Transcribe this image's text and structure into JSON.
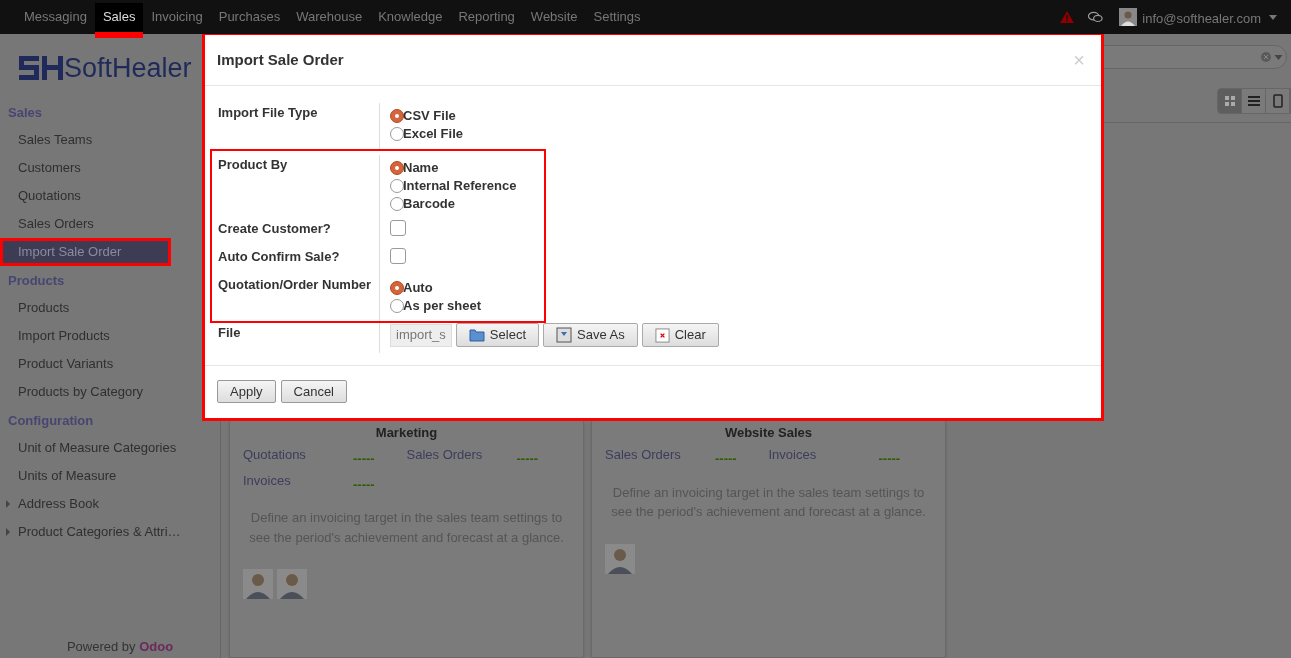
{
  "navbar": {
    "menu": [
      {
        "label": "Messaging",
        "selected": false,
        "highlighted": false
      },
      {
        "label": "Sales",
        "selected": true,
        "highlighted": true
      },
      {
        "label": "Invoicing",
        "selected": false,
        "highlighted": false
      },
      {
        "label": "Purchases",
        "selected": false,
        "highlighted": false
      },
      {
        "label": "Warehouse",
        "selected": false,
        "highlighted": false
      },
      {
        "label": "Knowledge",
        "selected": false,
        "highlighted": false
      },
      {
        "label": "Reporting",
        "selected": false,
        "highlighted": false
      },
      {
        "label": "Website",
        "selected": false,
        "highlighted": false
      },
      {
        "label": "Settings",
        "selected": false,
        "highlighted": false
      }
    ],
    "user": "info@softhealer.com"
  },
  "logo": "SoftHealer",
  "sidebar": {
    "sections": [
      {
        "title": "Sales",
        "items": [
          {
            "label": "Sales Teams",
            "selected": false,
            "highlighted": false,
            "expandable": false
          },
          {
            "label": "Customers",
            "selected": false,
            "highlighted": false,
            "expandable": false
          },
          {
            "label": "Quotations",
            "selected": false,
            "highlighted": false,
            "expandable": false
          },
          {
            "label": "Sales Orders",
            "selected": false,
            "highlighted": false,
            "expandable": false
          },
          {
            "label": "Import Sale Order",
            "selected": true,
            "highlighted": true,
            "expandable": false
          }
        ]
      },
      {
        "title": "Products",
        "items": [
          {
            "label": "Products",
            "selected": false,
            "highlighted": false,
            "expandable": false
          },
          {
            "label": "Import Products",
            "selected": false,
            "highlighted": false,
            "expandable": false
          },
          {
            "label": "Product Variants",
            "selected": false,
            "highlighted": false,
            "expandable": false
          },
          {
            "label": "Products by Category",
            "selected": false,
            "highlighted": false,
            "expandable": false
          }
        ]
      },
      {
        "title": "Configuration",
        "items": [
          {
            "label": "Unit of Measure Categories",
            "selected": false,
            "highlighted": false,
            "expandable": false
          },
          {
            "label": "Units of Measure",
            "selected": false,
            "highlighted": false,
            "expandable": false
          },
          {
            "label": "Address Book",
            "selected": false,
            "highlighted": false,
            "expandable": true
          },
          {
            "label": "Product Categories & Attri…",
            "selected": false,
            "highlighted": false,
            "expandable": true
          }
        ]
      }
    ],
    "powered_by": {
      "text": "Powered by",
      "brand": "Odoo"
    }
  },
  "view_switcher": [
    {
      "kind": "kanban",
      "selected": true
    },
    {
      "kind": "list",
      "selected": false
    },
    {
      "kind": "form",
      "selected": false
    }
  ],
  "cards": [
    {
      "title": "Marketing",
      "stats": [
        {
          "label": "Quotations",
          "value": "-----"
        },
        {
          "label": "Sales Orders",
          "value": "-----"
        },
        {
          "label": "Invoices",
          "value": "-----"
        }
      ],
      "note": "Define an invoicing target in the sales team settings to see the period's achievement and forecast at a glance.",
      "members": [
        {
          "kind": "picture"
        },
        {
          "kind": "picture"
        }
      ]
    },
    {
      "title": "Website Sales",
      "stats": [
        {
          "label": "Sales Orders",
          "value": "-----"
        },
        {
          "label": "Invoices",
          "value": "-----"
        }
      ],
      "note": "Define an invoicing target in the sales team settings to see the period's achievement and forecast at a glance.",
      "members": [
        {
          "kind": "picture"
        }
      ]
    }
  ],
  "dialog": {
    "title": "Import Sale Order",
    "close": "×",
    "highlighted": true,
    "fields": [
      {
        "kind": "radio",
        "label": "Import File Type",
        "highlighted": false,
        "options": [
          {
            "label": "CSV File",
            "selected": true
          },
          {
            "label": "Excel File",
            "selected": false
          }
        ]
      },
      {
        "kind": "radio",
        "label": "Product By",
        "highlighted": true,
        "options": [
          {
            "label": "Name",
            "selected": true
          },
          {
            "label": "Internal Reference",
            "selected": false
          },
          {
            "label": "Barcode",
            "selected": false
          }
        ]
      },
      {
        "kind": "checkbox",
        "label": "Create Customer?",
        "highlighted": true,
        "checked": false
      },
      {
        "kind": "checkbox",
        "label": "Auto Confirm Sale?",
        "highlighted": true,
        "checked": false
      },
      {
        "kind": "radio",
        "label": "Quotation/Order Number",
        "highlighted": true,
        "options": [
          {
            "label": "Auto",
            "selected": true
          },
          {
            "label": "As per sheet",
            "selected": false
          }
        ]
      },
      {
        "kind": "file",
        "label": "File",
        "highlighted": false,
        "value": "import_s",
        "buttons": [
          {
            "kind": "select",
            "label": "Select"
          },
          {
            "kind": "save",
            "label": "Save As"
          },
          {
            "kind": "clear",
            "label": "Clear"
          }
        ]
      }
    ],
    "buttons": [
      "Apply",
      "Cancel"
    ]
  }
}
